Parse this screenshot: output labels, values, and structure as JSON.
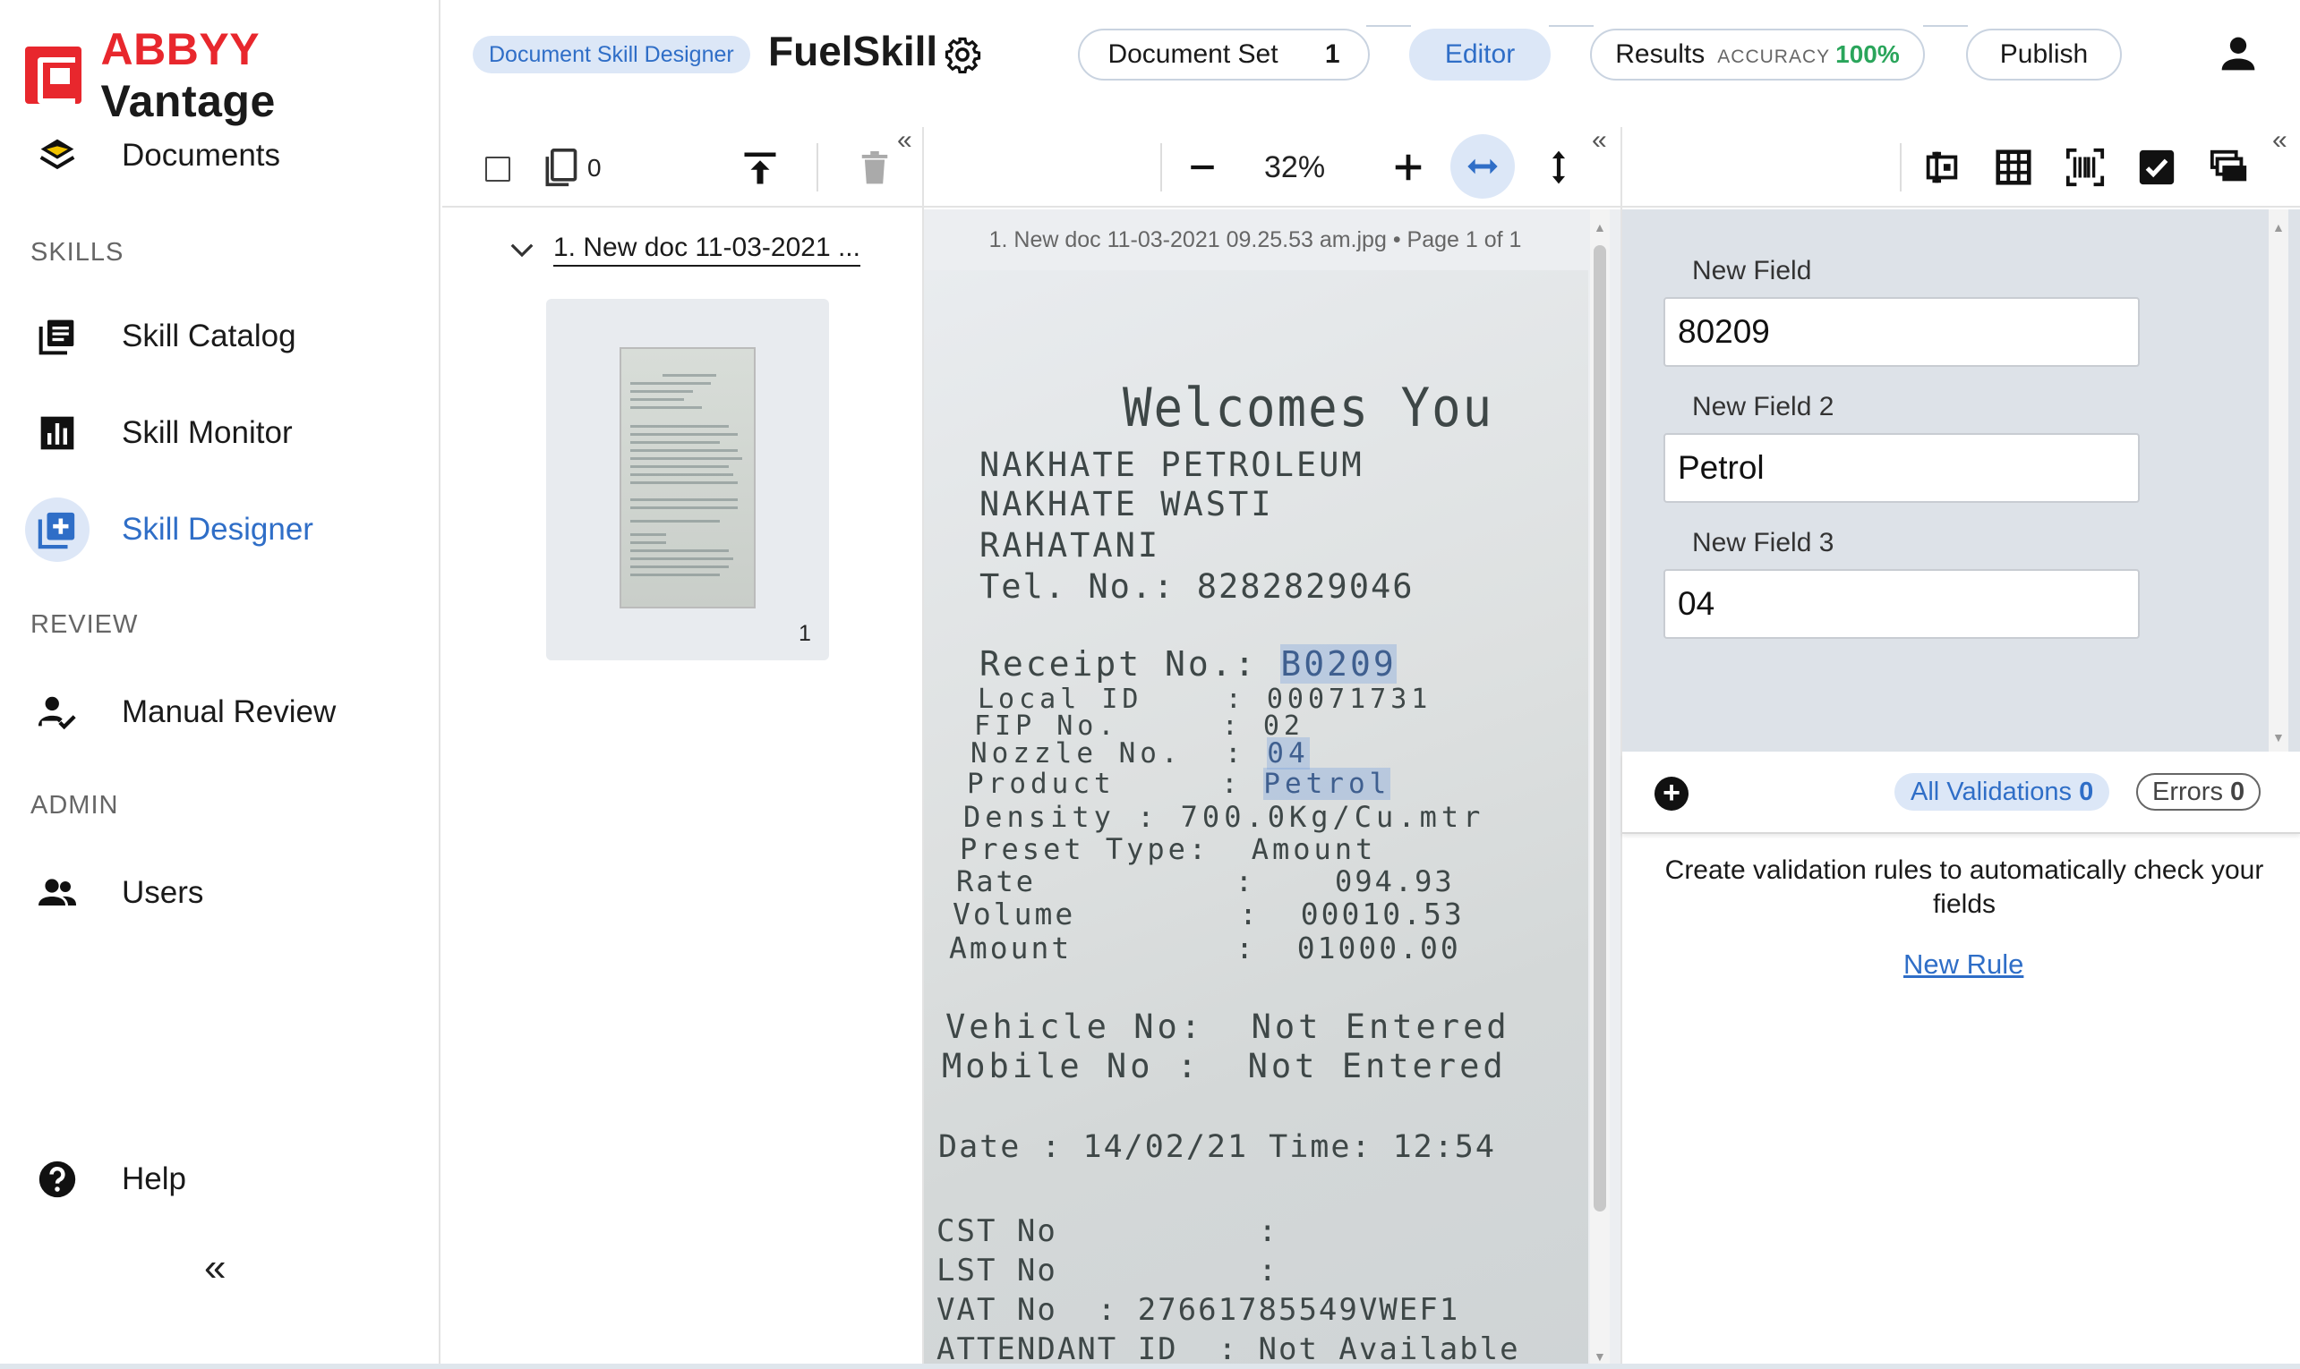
{
  "app": {
    "brand_abbyy": "ABBYY",
    "brand_vantage": "Vantage"
  },
  "sidebar": {
    "documents": "Documents",
    "sections": {
      "skills": "SKILLS",
      "review": "REVIEW",
      "admin": "ADMIN"
    },
    "skill_catalog": "Skill Catalog",
    "skill_monitor": "Skill Monitor",
    "skill_designer": "Skill Designer",
    "manual_review": "Manual Review",
    "users": "Users",
    "help": "Help",
    "collapse": "«"
  },
  "header": {
    "designer_pill": "Document Skill Designer",
    "skill_name": "FuelSkill",
    "steps": {
      "document_set": "Document Set",
      "document_set_count": "1",
      "editor": "Editor",
      "results": "Results",
      "accuracy_label": "ACCURACY",
      "accuracy_value": "100%",
      "publish": "Publish"
    }
  },
  "documents_pane": {
    "selected_count": "0",
    "collapse": "«",
    "doc_name": "1. New doc 11-03-2021 ...",
    "page_number": "1"
  },
  "viewer": {
    "zoom": "32%",
    "collapse": "«",
    "caption": "1. New doc 11-03-2021 09.25.53 am.jpg • Page 1 of 1",
    "receipt": {
      "welcome": "Welcomes You",
      "line1": "NAKHATE PETROLEUM",
      "line2": "NAKHATE WASTI",
      "line3": "RAHATANI",
      "tel": "Tel. No.: 8282829046",
      "receipt_label": "Receipt No.: ",
      "receipt_value": "B0209",
      "local_id": "Local ID    : 00071731",
      "fip": "FIP No.     : 02",
      "nozzle_label": "Nozzle No.  : ",
      "nozzle_value": "04",
      "product_label": "Product     : ",
      "product_value": "Petrol",
      "density": "Density : 700.0Kg/Cu.mtr",
      "preset": "Preset Type:  Amount",
      "rate": "Rate          :    094.93",
      "volume": "Volume        :  00010.53",
      "amount": "Amount        :  01000.00",
      "vehicle": "Vehicle No:  Not Entered",
      "mobile": "Mobile No :  Not Entered",
      "date": "Date : 14/02/21 Time: 12:54",
      "cst": "CST No          :",
      "lst": "LST No          :",
      "vat": "VAT No  : 27661785549VWEF1",
      "attendant": "ATTENDANT ID  : Not Available"
    }
  },
  "fields_pane": {
    "collapse": "«",
    "fields": [
      {
        "label": "New Field",
        "value": "80209"
      },
      {
        "label": "New Field 2",
        "value": "Petrol"
      },
      {
        "label": "New Field 3",
        "value": "04"
      }
    ]
  },
  "validations": {
    "all_label": "All Validations",
    "all_count": "0",
    "errors_label": "Errors",
    "errors_count": "0",
    "help_text": "Create validation rules to automatically check your fields",
    "new_rule": "New Rule"
  },
  "colors": {
    "brand_red": "#e8272d",
    "accent_blue": "#2f6ec7",
    "success_green": "#2aa55b"
  }
}
